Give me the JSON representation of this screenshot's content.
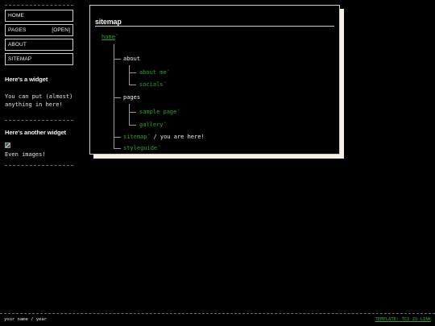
{
  "nav": {
    "items": [
      {
        "label": "HOME",
        "extra": ""
      },
      {
        "label": "PAGES",
        "extra": "[OPEN]"
      },
      {
        "label": "ABOUT",
        "extra": ""
      },
      {
        "label": "SITEMAP",
        "extra": ""
      }
    ]
  },
  "widgets": [
    {
      "title": "Here's a widget",
      "text": "You can put (almost) anything in here!"
    },
    {
      "title": "Here's another widget",
      "image": "broken-image",
      "text": "Even images!"
    }
  ],
  "main": {
    "title": "sitemap",
    "tree": {
      "home": "home",
      "about": "about",
      "about_me": "about me",
      "socials": "socials",
      "pages": "pages",
      "sample_page": "sample page",
      "gallery": "gallery",
      "sitemap": "sitemap",
      "you_are_here": "/ you are here!",
      "styleguide": "styleguide",
      "external_marker": "°"
    }
  },
  "footer": {
    "left": "your name / year",
    "right": "TEMPLATE: TCI ZO-LINK"
  },
  "colors": {
    "background": "#000000",
    "link": "#2aa52a",
    "panel_shadow": "#f5f2e4",
    "border": "#cfcfcf"
  }
}
